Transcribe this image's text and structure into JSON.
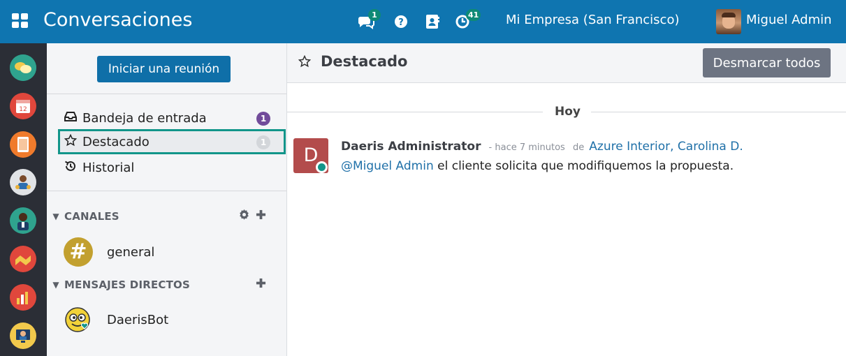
{
  "topbar": {
    "app_title": "Conversaciones",
    "chat_badge": "1",
    "activity_badge": "41",
    "company": "Mi Empresa (San Francisco)",
    "user_name": "Miguel Admin",
    "bg_color": "#0f75b0"
  },
  "sidebar": {
    "meet_button": "Iniciar una reunión",
    "mailboxes": [
      {
        "label": "Bandeja de entrada",
        "count": "1",
        "icon": "inbox-icon"
      },
      {
        "label": "Destacado",
        "count": "1",
        "icon": "star-icon"
      },
      {
        "label": "Historial",
        "icon": "history-icon"
      }
    ],
    "channels_title": "CANALES",
    "channels": [
      {
        "label": "general",
        "icon": "#"
      }
    ],
    "direct_title": "MENSAJES DIRECTOS",
    "direct": [
      {
        "label": "DaerisBot"
      }
    ]
  },
  "main": {
    "title": "Destacado",
    "unstar_button": "Desmarcar todos",
    "day_separator": "Hoy",
    "message": {
      "avatar_letter": "D",
      "author": "Daeris Administrator",
      "date": "- hace 7 minutos",
      "de": "de",
      "recipients": "Azure Interior, Carolina D.",
      "mention": "@Miguel Admin",
      "body": " el cliente solicita que modifiquemos la propuesta."
    }
  },
  "colors": {
    "accent": "#12958a",
    "primary": "#0f6fa8",
    "badge": "#714b9a"
  }
}
